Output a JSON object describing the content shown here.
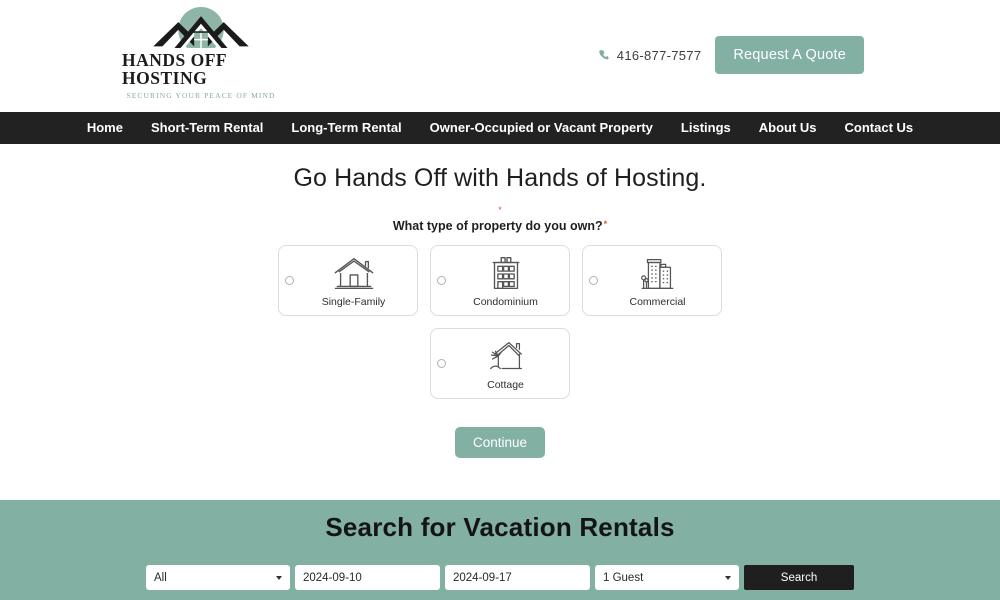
{
  "brand": {
    "logo_icon": "house-mountain-sun-logo",
    "name": "HANDS OFF HOSTING",
    "tagline": "SECURING YOUR PEACE OF MIND",
    "accent_color": "#82b0a2",
    "nav_bg_color": "#222222"
  },
  "header": {
    "phone_icon": "phone-icon",
    "phone": "416-877-7577",
    "quote_label": "Request A Quote"
  },
  "nav": {
    "items": [
      {
        "label": "Home"
      },
      {
        "label": "Short-Term Rental"
      },
      {
        "label": "Long-Term Rental"
      },
      {
        "label": "Owner-Occupied or Vacant Property"
      },
      {
        "label": "Listings"
      },
      {
        "label": "About Us"
      },
      {
        "label": "Contact Us"
      }
    ]
  },
  "main": {
    "title": "Go Hands Off with Hands of Hosting.",
    "required_marker": "*",
    "question": "What type of property do you own?",
    "choices": [
      {
        "label": "Single-Family",
        "icon": "house-icon",
        "selected": false
      },
      {
        "label": "Condominium",
        "icon": "condo-building-icon",
        "selected": false
      },
      {
        "label": "Commercial",
        "icon": "commercial-building-icon",
        "selected": false
      },
      {
        "label": "Cottage",
        "icon": "cottage-palm-icon",
        "selected": false
      }
    ],
    "continue_label": "Continue"
  },
  "search": {
    "title": "Search for Vacation Rentals",
    "property_type_value": "All",
    "property_type_options": [
      "All"
    ],
    "check_in_value": "2024-09-10",
    "check_out_value": "2024-09-17",
    "guests_value": "1 Guest",
    "guests_options": [
      "1 Guest"
    ],
    "search_label": "Search"
  }
}
